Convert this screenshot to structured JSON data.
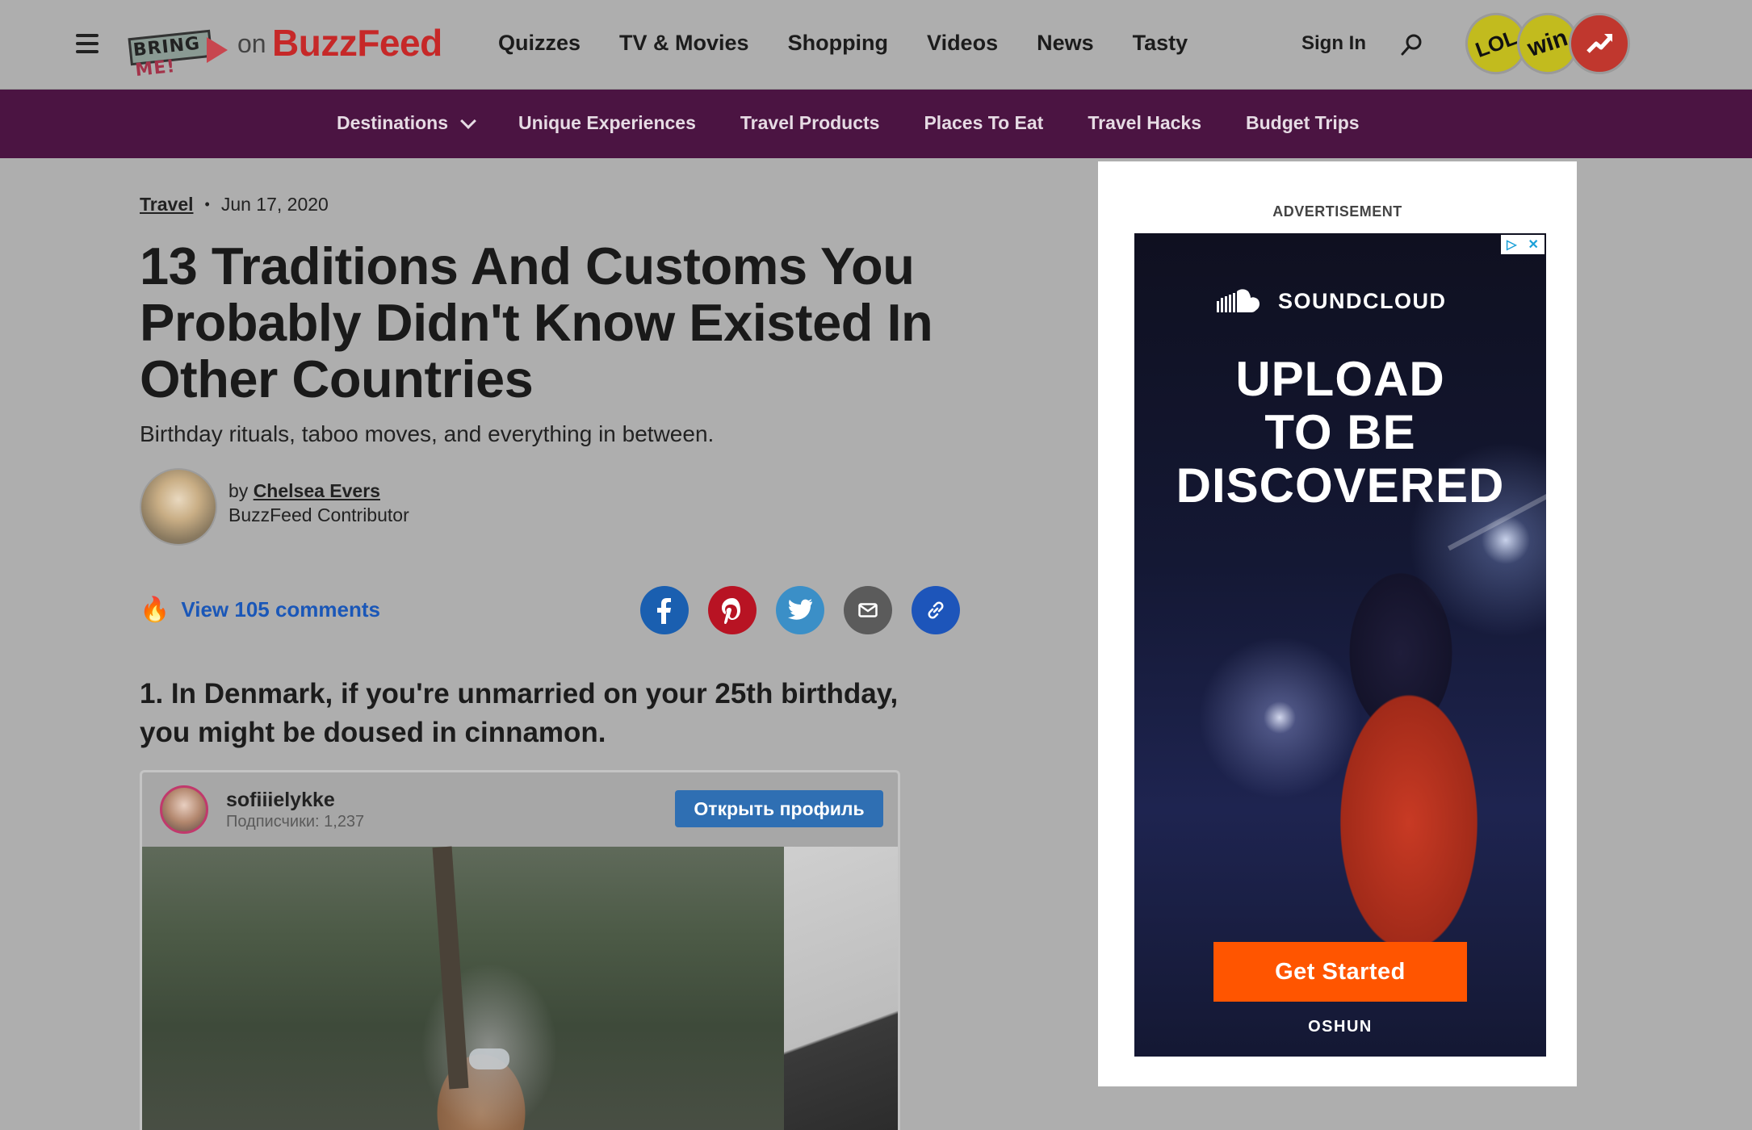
{
  "header": {
    "brand_sub": "BRING ME!",
    "brand_sub_parts": [
      "BRING",
      "ME!"
    ],
    "on_text": "on",
    "logo": "BuzzFeed",
    "nav": [
      "Quizzes",
      "TV & Movies",
      "Shopping",
      "Videos",
      "News",
      "Tasty"
    ],
    "sign_in": "Sign In",
    "badges": [
      "LOL",
      "win"
    ],
    "icons": [
      "menu-icon",
      "search-icon",
      "trending-icon"
    ]
  },
  "subnav": {
    "items": [
      "Destinations",
      "Unique Experiences",
      "Travel Products",
      "Places To Eat",
      "Travel Hacks",
      "Budget Trips"
    ],
    "background": "#4b1442"
  },
  "article": {
    "category": "Travel",
    "date": "Jun 17, 2020",
    "title": "13 Traditions And Customs You Probably Didn't Know Existed In Other Countries",
    "dek": "Birthday rituals, taboo moves, and everything in between.",
    "by": "by",
    "author": "Chelsea Evers",
    "author_role": "BuzzFeed Contributor",
    "comments_label": "View 105 comments",
    "share_icons": [
      "facebook-icon",
      "pinterest-icon",
      "twitter-icon",
      "email-icon",
      "link-icon"
    ],
    "item_1_heading": "1. In Denmark, if you're unmarried on your 25th birthday, you might be doused in cinnamon.",
    "embed": {
      "username": "sofiiielykke",
      "followers": "Подписчики: 1,237",
      "open_profile": "Открыть профиль"
    }
  },
  "ad": {
    "label": "ADVERTISEMENT",
    "brand": "SOUNDCLOUD",
    "headline_lines": [
      "UPLOAD",
      "TO BE",
      "DISCOVERED"
    ],
    "cta": "Get Started",
    "artist": "OSHUN",
    "cta_color": "#ff5500"
  }
}
